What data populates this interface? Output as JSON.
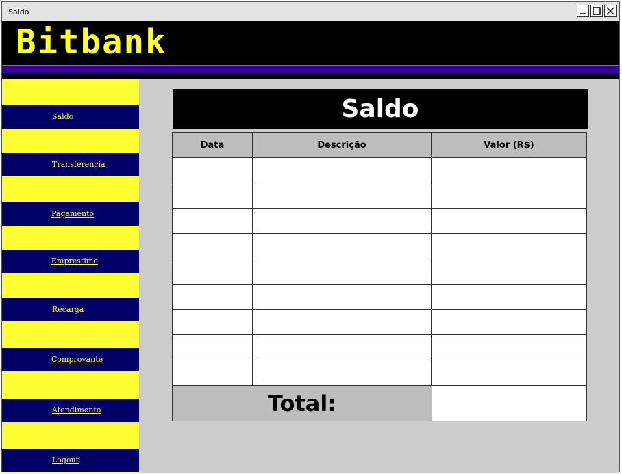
{
  "window": {
    "title": "Saldo",
    "controls": [
      "minimize-icon",
      "maximize-icon",
      "close-icon"
    ]
  },
  "header": {
    "logo": "Bitbank"
  },
  "colors": {
    "header_bg": "#000000",
    "logo": "#ffff33",
    "accent_bar": "#330099",
    "sidebar_bg": "#ffff33",
    "nav_item_bg": "#000066",
    "content_bg": "#cccccc",
    "table_header_bg": "#bdbdbd"
  },
  "sidebar": {
    "items": [
      {
        "label": "Saldo"
      },
      {
        "label": "Transferencia"
      },
      {
        "label": "Pagamento"
      },
      {
        "label": "Emprestimo"
      },
      {
        "label": "Recarga"
      },
      {
        "label": "Comprovante"
      },
      {
        "label": "Atendimento"
      },
      {
        "label": "Logout"
      }
    ]
  },
  "main": {
    "title": "Saldo",
    "table": {
      "headers": [
        "Data",
        "Descrição",
        "Valor (R$)"
      ],
      "rows": [
        [
          "",
          "",
          ""
        ],
        [
          "",
          "",
          ""
        ],
        [
          "",
          "",
          ""
        ],
        [
          "",
          "",
          ""
        ],
        [
          "",
          "",
          ""
        ],
        [
          "",
          "",
          ""
        ],
        [
          "",
          "",
          ""
        ],
        [
          "",
          "",
          ""
        ],
        [
          "",
          "",
          ""
        ]
      ]
    },
    "total_label": "Total:",
    "total_value": ""
  }
}
